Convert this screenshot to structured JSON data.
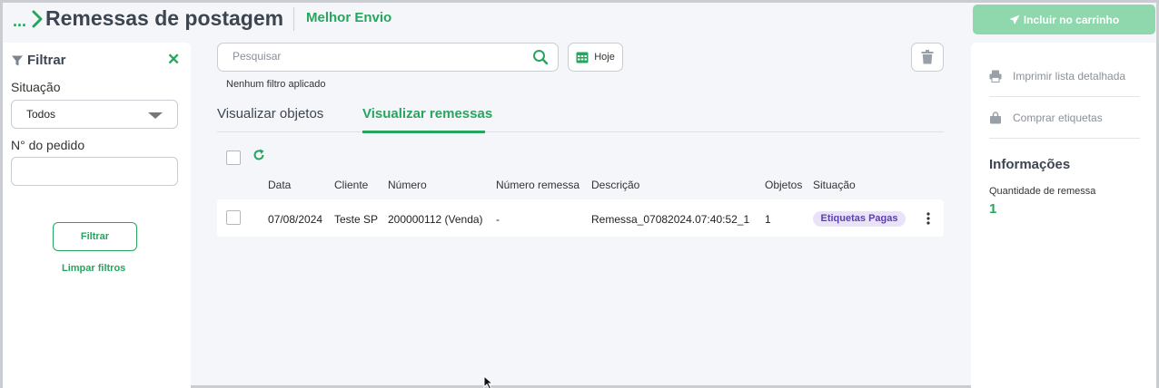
{
  "header": {
    "breadcrumb_ellipsis": "...",
    "title": "Remessas de postagem",
    "brand": "Melhor Envio",
    "cart_button": "Incluir no carrinho"
  },
  "filter": {
    "title": "Filtrar",
    "status_label": "Situação",
    "status_value": "Todos",
    "order_label": "N° do pedido",
    "order_value": "",
    "apply_button": "Filtrar",
    "clear_link": "Limpar filtros"
  },
  "toolbar": {
    "search_placeholder": "Pesquisar",
    "date_button": "Hoje",
    "no_filter_text": "Nenhum filtro aplicado"
  },
  "tabs": [
    {
      "label": "Visualizar objetos",
      "active": false
    },
    {
      "label": "Visualizar remessas",
      "active": true
    }
  ],
  "table": {
    "columns": [
      "Data",
      "Cliente",
      "Número",
      "Número remessa",
      "Descrição",
      "Objetos",
      "Situação"
    ],
    "rows": [
      {
        "date": "07/08/2024",
        "client": "Teste SP",
        "number": "200000112 (Venda)",
        "shipment_number": "-",
        "description": "Remessa_07082024.07:40:52_1",
        "objects": "1",
        "status": "Etiquetas Pagas"
      }
    ]
  },
  "side": {
    "print_list": "Imprimir lista detalhada",
    "buy_labels": "Comprar etiquetas",
    "info_title": "Informações",
    "shipment_qty_label": "Quantidade de remessa",
    "shipment_qty_value": "1"
  },
  "colors": {
    "brand_green": "#27a55f",
    "cart_button_bg": "#8fd8ae",
    "badge_bg": "#e8e3f8",
    "badge_text": "#5e3eb0"
  }
}
